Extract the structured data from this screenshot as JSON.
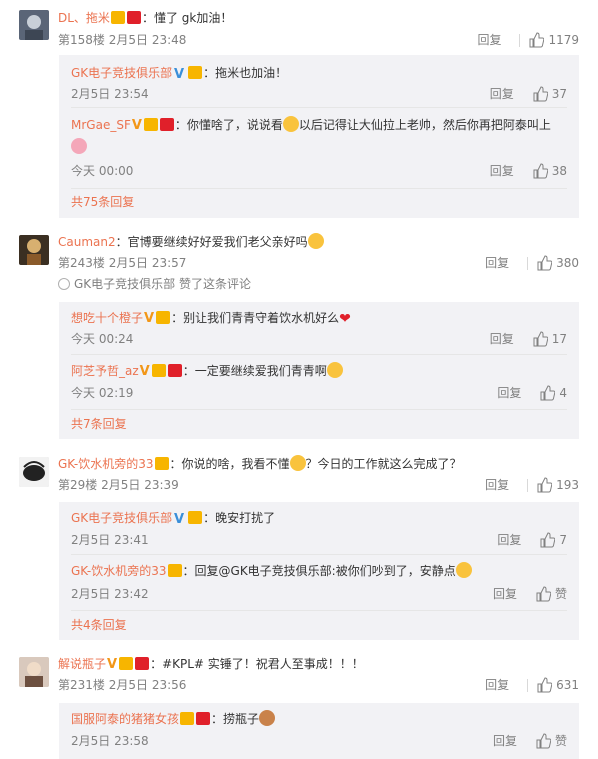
{
  "comments": [
    {
      "user": "DL、拖米",
      "text": "：懂了 gk加油！",
      "floor": "第158楼",
      "time": "2月5日 23:48",
      "reply": "回复",
      "likes": "1179",
      "avatar_color": "#556070",
      "replies": [
        {
          "user": "GK电子竞技俱乐部",
          "text": "：拖米也加油！",
          "time": "2月5日 23:54",
          "reply": "回复",
          "likes": "37"
        },
        {
          "user": "MrGae_SF",
          "text": "：你懂啥了，说说看",
          "text2": "以后记得让大仙拉上老帅，然后你再把阿泰叫上",
          "time": "今天 00:00",
          "reply": "回复",
          "likes": "38"
        }
      ],
      "more": "共75条回复"
    },
    {
      "user": "Cauman2",
      "text": "：官博要继续好好爱我们老父亲好吗",
      "floor": "第243楼",
      "time": "2月5日 23:57",
      "reply": "回复",
      "likes": "380",
      "avatar_color": "#8a6a3a",
      "liked_by": "GK电子竞技俱乐部 赞了这条评论",
      "replies": [
        {
          "user": "想吃十个橙子",
          "text": "：别让我们青青守着饮水机好么",
          "time": "今天 00:24",
          "reply": "回复",
          "likes": "17"
        },
        {
          "user": "阿芝予哲_az",
          "text": "：一定要继续爱我们青青啊",
          "time": "今天 02:19",
          "reply": "回复",
          "likes": "4"
        }
      ],
      "more": "共7条回复"
    },
    {
      "user": "GK-饮水机旁的33",
      "text": "：你说的啥，我看不懂",
      "text2": "？今日的工作就这么完成了？",
      "floor": "第29楼",
      "time": "2月5日 23:39",
      "reply": "回复",
      "likes": "193",
      "avatar_color": "#e8e8e8",
      "replies": [
        {
          "user": "GK电子竞技俱乐部",
          "text": "：晚安打扰了",
          "time": "2月5日 23:41",
          "reply": "回复",
          "likes": "7"
        },
        {
          "user": "GK-饮水机旁的33",
          "text": "：回复@GK电子竞技俱乐部:被你们吵到了，安静点",
          "time": "2月5日 23:42",
          "reply": "回复",
          "likes": "赞"
        }
      ],
      "more": "共4条回复"
    },
    {
      "user": "解说瓶子",
      "text": "：#KPL# 实锤了！祝君人至事成！！！",
      "floor": "第231楼",
      "time": "2月5日 23:56",
      "reply": "回复",
      "likes": "631",
      "avatar_color": "#b08870",
      "replies": [
        {
          "user": "国服阿泰的猪猪女孩",
          "text": "：捞瓶子",
          "time": "2月5日 23:58",
          "reply": "回复",
          "likes": "赞"
        }
      ]
    }
  ],
  "colors": {
    "accent": "#eb7350",
    "meta": "#808080",
    "subbg": "#f2f2f5"
  },
  "icons": [
    "like-icon",
    "crown-badge",
    "red-badge",
    "verified-badge",
    "emoji"
  ]
}
